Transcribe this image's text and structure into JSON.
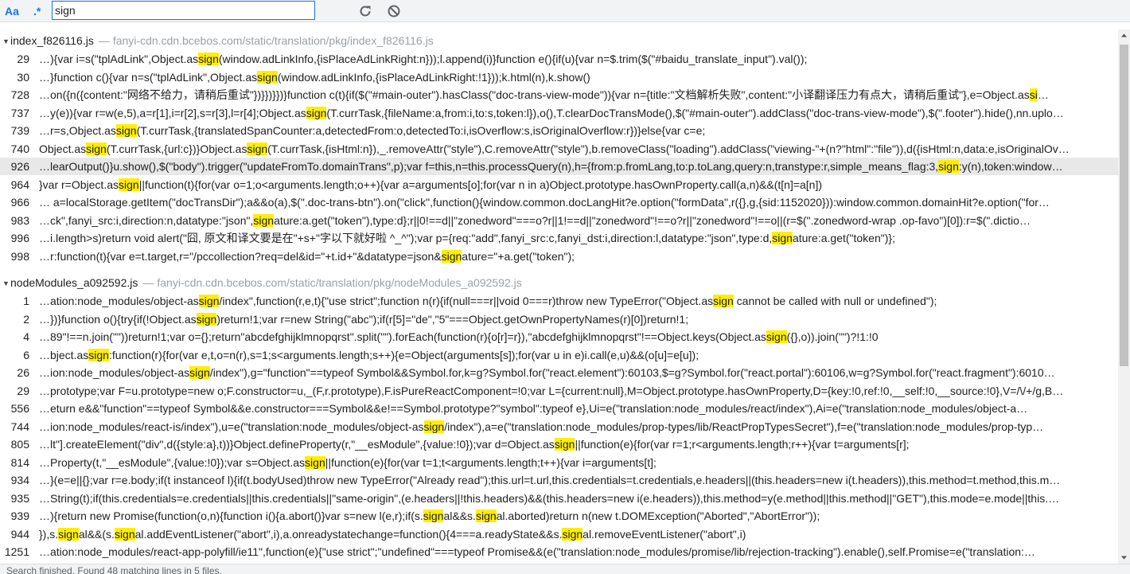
{
  "toolbar": {
    "case_label": "Aa",
    "regex_label": ".*",
    "search_value": "sign",
    "refresh_icon": "refresh-icon",
    "clear_icon": "clear-icon"
  },
  "colors": {
    "accent": "#1a73e8",
    "highlight": "#ffee00",
    "selected_row": "#e8e8e8"
  },
  "files": [
    {
      "name": "index_f826116.js",
      "separator": "—",
      "url": "fanyi-cdn.cdn.bcebos.com/static/translation/pkg/index_f826116.js",
      "rows": [
        {
          "line": "29",
          "segs": [
            "…){var i=s(\"tplAdLink\",Object.as",
            "sign",
            "(window.adLinkInfo,{isPlaceAdLinkRight:n}));l.append(i)}function e(){if(u){var n=$.trim($(\"#baidu_translate_input\").val());"
          ]
        },
        {
          "line": "30",
          "segs": [
            "…}function c(){var n=s(\"tplAdLink\",Object.as",
            "sign",
            "(window.adLinkInfo,{isPlaceAdLinkRight:!1}));k.html(n),k.show()"
          ]
        },
        {
          "line": "728",
          "segs": [
            "…on({n({content:\"网络不给力，请稍后重试\"})}})}})}function c(t){if($(\"#main-outer\").hasClass(\"doc-trans-view-mode\")){var n={title:\"文档解析失败\",content:\"小译翻译压力有点大，请稍后重试\"},e=Object.as",
            "si",
            "…"
          ]
        },
        {
          "line": "737",
          "segs": [
            "…y(e)){var r=w(e,5),a=r[1],i=r[2],s=r[3],l=r[4];Object.as",
            "sign",
            "(T.currTask,{fileName:a,from:i,to:s,token:l}),o(),T.clearDocTransMode(),$(\"#main-outer\").addClass(\"doc-trans-view-mode\"),$(\".footer\").hide(),nn.uplo…"
          ]
        },
        {
          "line": "739",
          "segs": [
            "…r=s,Object.as",
            "sign",
            "(T.currTask,{translatedSpanCounter:a,detectedFrom:o,detectedTo:i,isOverflow:s,isOriginalOverflow:r})}else{var c=e;"
          ]
        },
        {
          "line": "740",
          "segs": [
            "Object.as",
            "sign",
            "(T.currTask,{url:c})}Object.as",
            "sign",
            "(T.currTask,{isHtml:n}),_.removeAttr(\"style\"),C.removeAttr(\"style\"),b.removeClass(\"loading\").addClass(\"viewing-\"+(n?\"html\":\"file\")),d({isHtml:n,data:e,isOriginalOv…"
          ]
        },
        {
          "line": "926",
          "selected": true,
          "segs": [
            "…learOutput()}u.show(),$(\"body\").trigger(\"updateFromTo.domainTrans\",p);var f=this,n=this.processQuery(n),h={from:p.fromLang,to:p.toLang,query:n,transtype:r,simple_means_flag:3,",
            "sign",
            ":y(n),token:window…"
          ]
        },
        {
          "line": "964",
          "segs": [
            "}var r=Object.as",
            "sign",
            "||function(t){for(var o=1;o<arguments.length;o++){var a=arguments[o];for(var n in a)Object.prototype.hasOwnProperty.call(a,n)&&(t[n]=a[n])"
          ]
        },
        {
          "line": "966",
          "segs": [
            "… a=localStorage.getItem(\"docTransDir\");a&&o(a),$(\".doc-trans-btn\").on(\"click\",function(){window.common.docLangHit?e.option(\"formData\",r({},g,{sid:1152020})):window.common.domainHit?e.option(\"for…"
          ]
        },
        {
          "line": "983",
          "segs": [
            "…ck\",fanyi_src:i,direction:n,datatype:\"json\",",
            "sign",
            "ature:a.get(\"token\"),type:d};r||0!==d||\"zonedword\"===o?r||1!==d||\"zonedword\"!==o?r||\"zonedword\"!==o||(r=$(\".zonedword-wrap .op-favo\")[0]):r=$(\".dictio…"
          ]
        },
        {
          "line": "996",
          "segs": [
            "…i.length>s)return void alert(\"囧, 原文和译文要是在\"+s+\"字以下就好啦 ^_^\");var p={req:\"add\",fanyi_src:c,fanyi_dst:i,direction:l,datatype:\"json\",type:d,",
            "sign",
            "ature:a.get(\"token\")};"
          ]
        },
        {
          "line": "998",
          "segs": [
            "…r:function(t){var e=t.target,r=\"/pccollection?req=del&id=\"+t.id+\"&datatype=json&",
            "sign",
            "ature=\"+a.get(\"token\");"
          ]
        }
      ]
    },
    {
      "name": "nodeModules_a092592.js",
      "separator": "—",
      "url": "fanyi-cdn.cdn.bcebos.com/static/translation/pkg/nodeModules_a092592.js",
      "rows": [
        {
          "line": "1",
          "segs": [
            "…ation:node_modules/object-as",
            "sign",
            "/index\",function(r,e,t){\"use strict\";function n(r){if(null===r||void 0===r)throw new TypeError(\"Object.as",
            "sign",
            " cannot be called with null or undefined\");"
          ]
        },
        {
          "line": "2",
          "segs": [
            "…})}function o(){try{if(!Object.as",
            "sign",
            ")return!1;var r=new String(\"abc\");if(r[5]=\"de\",\"5\"===Object.getOwnPropertyNames(r)[0])return!1;"
          ]
        },
        {
          "line": "4",
          "segs": [
            "…89\"!==n.join(\"\"))return!1;var o={};return\"abcdefghijklmnopqrst\".split(\"\").forEach(function(r){o[r]=r}),\"abcdefghijklmnopqrst\"!==Object.keys(Object.as",
            "sign",
            "({},o)).join(\"\")?!1:!0"
          ]
        },
        {
          "line": "6",
          "segs": [
            "…bject.as",
            "sign",
            ":function(r){for(var e,t,o=n(r),s=1;s<arguments.length;s++){e=Object(arguments[s]);for(var u in e)i.call(e,u)&&(o[u]=e[u]);"
          ]
        },
        {
          "line": "26",
          "segs": [
            "…ion:node_modules/object-as",
            "sign",
            "/index\"),g=\"function\"==typeof Symbol&&Symbol.for,k=g?Symbol.for(\"react.element\"):60103,$=g?Symbol.for(\"react.portal\"):60106,w=g?Symbol.for(\"react.fragment\"):6010…"
          ]
        },
        {
          "line": "29",
          "segs": [
            "…prototype;var F=u.prototype=new o;F.constructor=u,_(F,r.prototype),F.isPureReactComponent=!0;var L={current:null},M=Object.prototype.hasOwnProperty,D={key:!0,ref:!0,__self:!0,__source:!0},V=/\\/+/g,B…"
          ]
        },
        {
          "line": "556",
          "segs": [
            "…eturn e&&\"function\"==typeof Symbol&&e.constructor===Symbol&&e!==Symbol.prototype?\"symbol\":typeof e},Ui=e(\"translation:node_modules/react/index\"),Ai=e(\"translation:node_modules/object-a…"
          ]
        },
        {
          "line": "744",
          "segs": [
            "…ion:node_modules/react-is/index\"),u=e(\"translation:node_modules/object-as",
            "sign",
            "/index\"),a=e(\"translation:node_modules/prop-types/lib/ReactPropTypesSecret\"),f=e(\"translation:node_modules/prop-typ…"
          ]
        },
        {
          "line": "805",
          "segs": [
            "…lt\"].createElement(\"div\",d({style:a},t))}Object.defineProperty(r,\"__esModule\",{value:!0});var d=Object.as",
            "sign",
            "||function(e){for(var r=1;r<arguments.length;r++){var t=arguments[r];"
          ]
        },
        {
          "line": "814",
          "segs": [
            "…Property(t,\"__esModule\",{value:!0});var s=Object.as",
            "sign",
            "||function(e){for(var t=1;t<arguments.length;t++){var i=arguments[t];"
          ]
        },
        {
          "line": "934",
          "segs": [
            "…}(e=e||{};var r=e.body;if(t instanceof l){if(t.bodyUsed)throw new TypeError(\"Already read\");this.url=t.url,this.credentials=t.credentials,e.headers||(this.headers=new i(t.headers)),this.method=t.method,this.m…"
          ]
        },
        {
          "line": "935",
          "segs": [
            "…String(t);if(this.credentials=e.credentials||this.credentials||\"same-origin\",(e.headers||!this.headers)&&(this.headers=new i(e.headers)),this.method=y(e.method||this.method||\"GET\"),this.mode=e.mode||this.…"
          ]
        },
        {
          "line": "939",
          "segs": [
            "…){return new Promise(function(o,n){function i(){a.abort()}var s=new l(e,r);if(s.",
            "sign",
            "al&&s.",
            "sign",
            "al.aborted)return n(new t.DOMException(\"Aborted\",\"AbortError\"));"
          ]
        },
        {
          "line": "944",
          "segs": [
            "}),s.",
            "sign",
            "al&&(s.",
            "sign",
            "al.addEventListener(\"abort\",i),a.onreadystatechange=function(){4===a.readyState&&s.",
            "sign",
            "al.removeEventListener(\"abort\",i)"
          ]
        },
        {
          "line": "1251",
          "segs": [
            "…ation:node_modules/react-app-polyfill/ie11\",function(e){\"use strict\";\"undefined\"===typeof Promise&&(e(\"translation:node_modules/promise/lib/rejection-tracking\").enable(),self.Promise=e(\"translation:…"
          ]
        }
      ]
    }
  ],
  "status": {
    "text": "Search finished. Found 48 matching lines in 5 files."
  }
}
